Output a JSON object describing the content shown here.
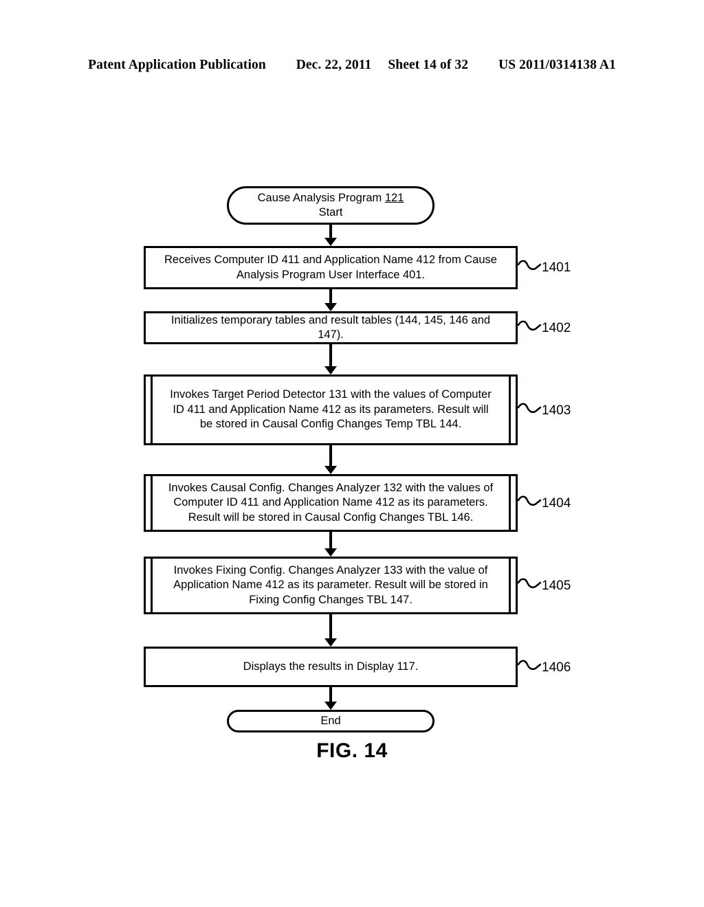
{
  "header": {
    "publication": "Patent Application Publication",
    "date": "Dec. 22, 2011",
    "sheet": "Sheet 14 of 32",
    "patent_number": "US 2011/0314138 A1"
  },
  "figure": {
    "caption": "FIG. 14"
  },
  "flowchart": {
    "start": {
      "line1_text": "Cause Analysis Program ",
      "line1_ref": "121",
      "line2": "Start"
    },
    "end": {
      "label": "End"
    },
    "steps": [
      {
        "ref": "1401",
        "type": "process",
        "text": "Receives Computer ID 411 and Application Name 412 from Cause Analysis Program User Interface 401."
      },
      {
        "ref": "1402",
        "type": "process",
        "text": "Initializes temporary tables and result tables (144, 145, 146 and 147)."
      },
      {
        "ref": "1403",
        "type": "predefined-process",
        "text": "Invokes Target Period Detector 131 with the values of Computer ID 411 and Application Name 412 as its parameters. Result will be stored in Causal Config Changes Temp TBL 144."
      },
      {
        "ref": "1404",
        "type": "predefined-process",
        "text": "Invokes Causal Config. Changes Analyzer 132 with the values of Computer ID 411 and Application Name 412 as its parameters. Result will be stored in Causal Config Changes TBL 146."
      },
      {
        "ref": "1405",
        "type": "predefined-process",
        "text": "Invokes Fixing Config. Changes Analyzer 133 with the value of Application Name 412 as its parameter. Result will be stored in Fixing Config Changes TBL 147."
      },
      {
        "ref": "1406",
        "type": "process",
        "text": "Displays the results in Display 117."
      }
    ]
  }
}
